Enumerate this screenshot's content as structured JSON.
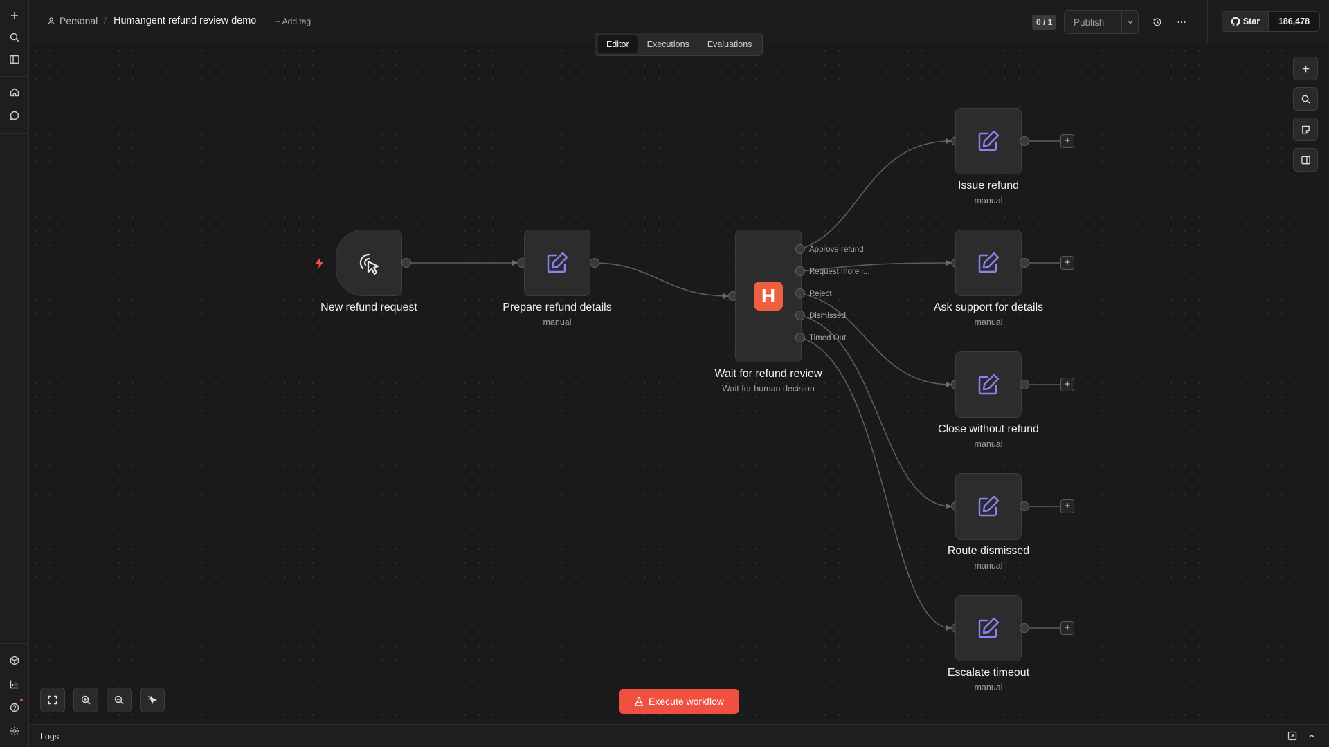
{
  "header": {
    "project": "Personal",
    "separator": "/",
    "workflow_title": "Humangent refund review demo",
    "add_tag": "+ Add tag",
    "counter": "0 / 1",
    "publish_label": "Publish",
    "github_star": "Star",
    "github_count": "186,478"
  },
  "tabs": [
    {
      "label": "Editor",
      "active": true
    },
    {
      "label": "Executions",
      "active": false
    },
    {
      "label": "Evaluations",
      "active": false
    }
  ],
  "nodes": {
    "trigger": {
      "title": "New refund request",
      "icon": "cursor-click-icon"
    },
    "prepare": {
      "title": "Prepare refund details",
      "subtitle": "manual",
      "icon": "edit-icon"
    },
    "wait": {
      "title": "Wait for refund review",
      "subtitle": "Wait for human decision",
      "badge": "H",
      "outputs": [
        "Approve refund",
        "Request more i...",
        "Reject",
        "Dismissed",
        "Timed Out"
      ]
    },
    "targets": [
      {
        "title": "Issue refund",
        "subtitle": "manual"
      },
      {
        "title": "Ask support for details",
        "subtitle": "manual"
      },
      {
        "title": "Close without refund",
        "subtitle": "manual"
      },
      {
        "title": "Route dismissed",
        "subtitle": "manual"
      },
      {
        "title": "Escalate timeout",
        "subtitle": "manual"
      }
    ]
  },
  "canvas": {
    "execute_button": "Execute workflow",
    "plus": "+"
  },
  "logs": {
    "label": "Logs"
  },
  "colors": {
    "accent": "#f0503f",
    "badge": "#ee5f3f",
    "icon_purple": "#8b83f5",
    "bolt": "#f0503f"
  }
}
